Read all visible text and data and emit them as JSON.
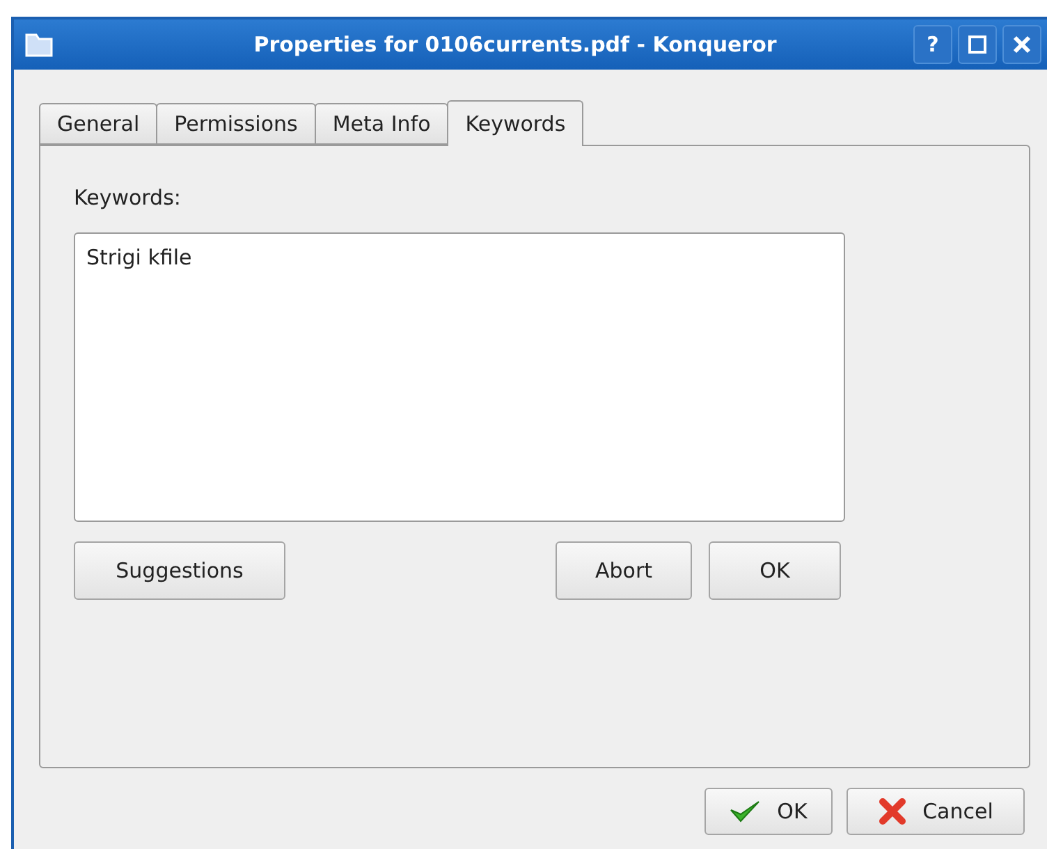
{
  "window": {
    "title": "Properties for 0106currents.pdf - Konqueror",
    "controls": [
      {
        "kind": "help",
        "label": "?"
      },
      {
        "kind": "maximize"
      },
      {
        "kind": "close"
      }
    ]
  },
  "tabs": [
    {
      "label": "General",
      "selected": false
    },
    {
      "label": "Permissions",
      "selected": false
    },
    {
      "label": "Meta Info",
      "selected": false
    },
    {
      "label": "Keywords",
      "selected": true
    }
  ],
  "keywords": {
    "label": "Keywords:",
    "value": "Strigi kfile"
  },
  "panel_buttons": [
    {
      "label": "Suggestions"
    },
    {
      "label": "Abort"
    },
    {
      "label": "OK"
    }
  ],
  "dialog_buttons": [
    {
      "kind": "ok",
      "label": "OK"
    },
    {
      "kind": "cancel",
      "label": "Cancel"
    }
  ]
}
